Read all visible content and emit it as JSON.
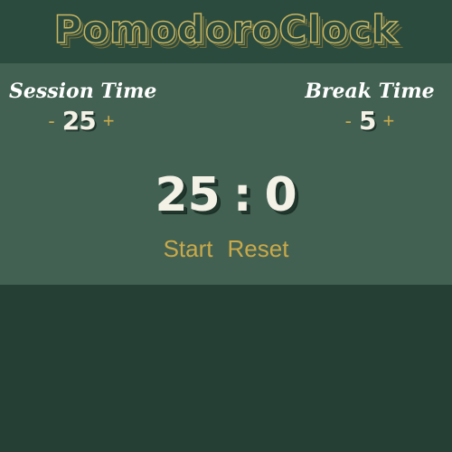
{
  "header": {
    "title": "PomodoroClock"
  },
  "session": {
    "label": "Session Time",
    "decrement": "-",
    "value": "25",
    "increment": "+"
  },
  "break": {
    "label": "Break Time",
    "decrement": "-",
    "value": "5",
    "increment": "+"
  },
  "timer": {
    "minutes": "25",
    "separator": ":",
    "seconds": "0"
  },
  "controls": {
    "start_label": "Start",
    "reset_label": "Reset"
  },
  "colors": {
    "page_background": "#253f35",
    "header_background": "#2b4b3f",
    "panel_background": "#426152",
    "accent_gold": "#c9a94a",
    "digit_cream": "#f4f1e6",
    "label_white": "#ffffff"
  }
}
